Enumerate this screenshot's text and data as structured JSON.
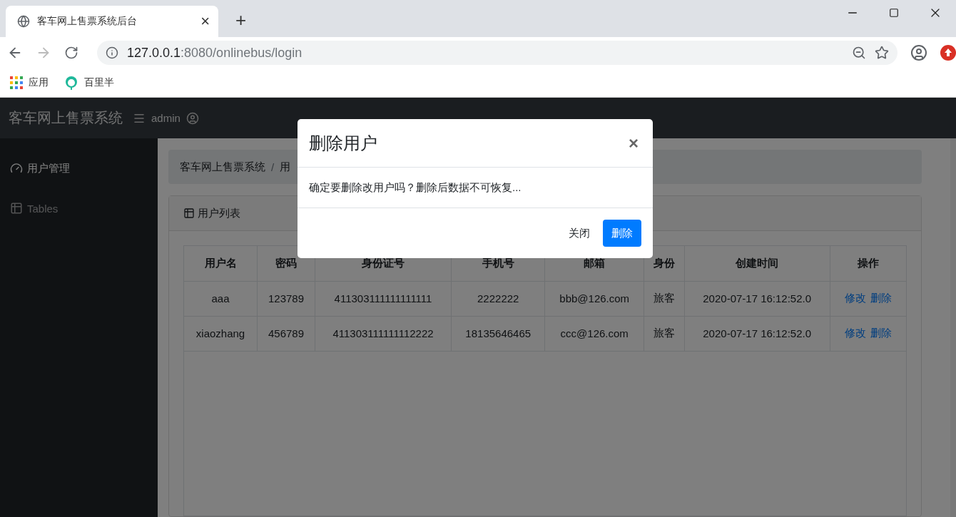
{
  "browser": {
    "tab_title": "客车网上售票系统后台",
    "close_tab": "×",
    "new_tab": "+",
    "address_host": "127.0.0.1",
    "address_path": ":8080/onlinebus/login",
    "bookmarks": [
      {
        "label": "应用",
        "kind": "apps"
      },
      {
        "label": "百里半",
        "kind": "site"
      }
    ]
  },
  "navbar": {
    "brand": "客车网上售票系统",
    "user": "admin"
  },
  "sidebar": {
    "items": [
      {
        "label": "用户管理",
        "kind": "gauge",
        "selected": true
      },
      {
        "label": "Tables",
        "kind": "table",
        "selected": false
      }
    ]
  },
  "breadcrumb": [
    "客车网上售票系统",
    "用"
  ],
  "breadcrumb_separator": "/",
  "card": {
    "title": "用户列表"
  },
  "table": {
    "columns": [
      "用户名",
      "密码",
      "身份证号",
      "手机号",
      "邮箱",
      "身份",
      "创建时间",
      "操作"
    ],
    "rows": [
      {
        "cells": [
          "aaa",
          "123789",
          "411303111111111111",
          "2222222",
          "bbb@126.com",
          "旅客",
          "2020-07-17 16:12:52.0"
        ],
        "actions": [
          "修改",
          "删除"
        ]
      },
      {
        "cells": [
          "xiaozhang",
          "456789",
          "411303111111112222",
          "18135646465",
          "ccc@126.com",
          "旅客",
          "2020-07-17 16:12:52.0"
        ],
        "actions": [
          "修改",
          "删除"
        ]
      }
    ]
  },
  "modal": {
    "title": "删除用户",
    "close": "×",
    "message": "确定要删除改用户吗？删除后数据不可恢复...",
    "buttons": [
      {
        "label": "关闭",
        "kind": "secondary"
      },
      {
        "label": "删除",
        "kind": "primary"
      }
    ]
  }
}
